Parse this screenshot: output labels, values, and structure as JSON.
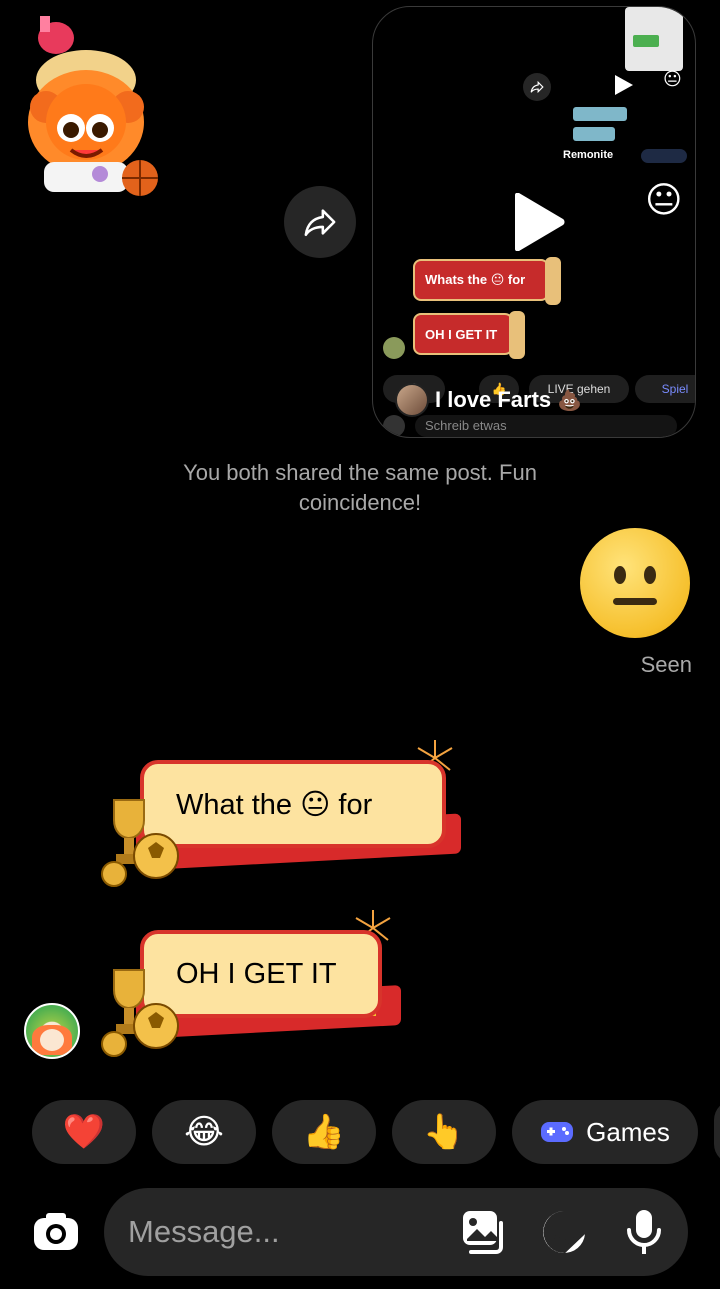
{
  "shared_post": {
    "caption": "I love Farts",
    "caption_emoji": "💩",
    "mini_bubbles": [
      "Whats the 😐 for",
      "OH I GET IT"
    ],
    "mini_remonite": "Remonite",
    "pills": [
      "LIVE gehen",
      "Spiel"
    ],
    "message_placeholder": "Schreib etwas"
  },
  "notice": "You both shared the same post. Fun coincidence!",
  "seen_label": "Seen",
  "messages": [
    {
      "text": "What the 😐 for"
    },
    {
      "text": "OH I GET IT"
    }
  ],
  "quick_reactions": [
    "❤️",
    "😂",
    "👍",
    "👆"
  ],
  "games_label": "Games",
  "composer": {
    "placeholder": "Message..."
  },
  "colors": {
    "background": "#000000",
    "chip_bg": "#262626",
    "bubble_fill": "#fde3a0",
    "bubble_border": "#d8342b",
    "games_icon": "#5b6bff"
  },
  "icons": [
    "sticker",
    "forward-icon",
    "play-icon",
    "camera-icon",
    "gallery-icon",
    "sticker-icon",
    "microphone-icon",
    "gamepad-icon",
    "trophy-icon"
  ]
}
